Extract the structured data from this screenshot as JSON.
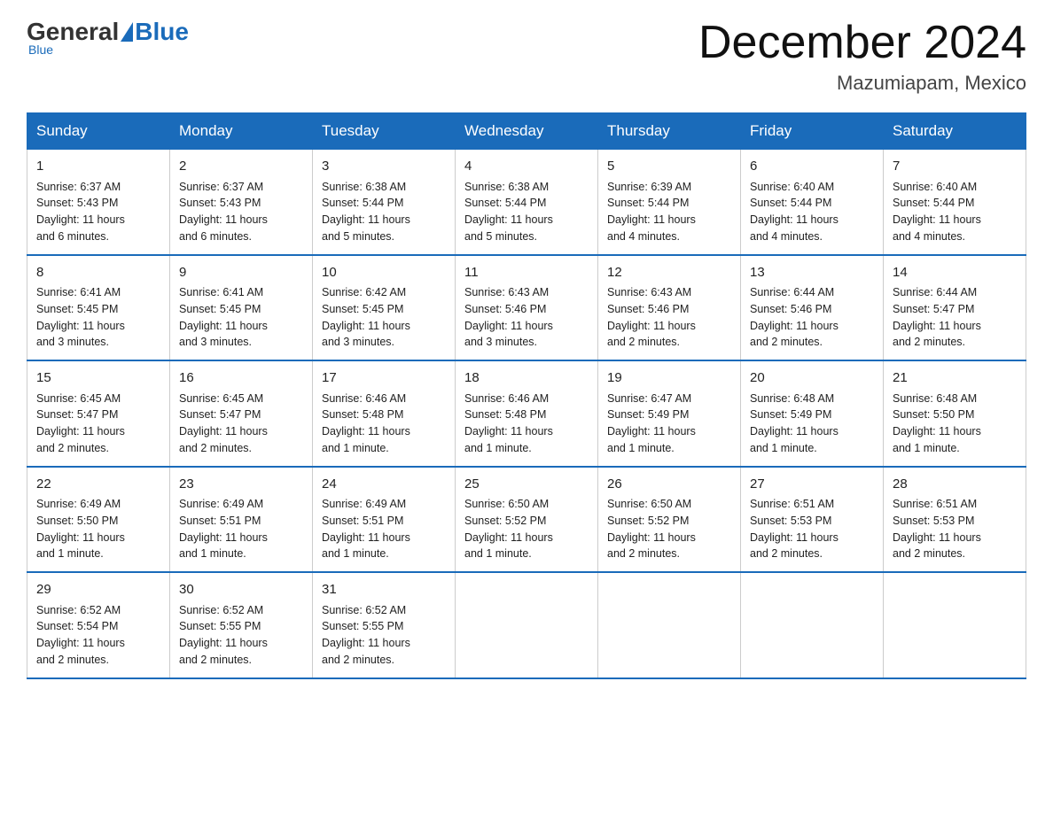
{
  "header": {
    "logo": {
      "general": "General",
      "blue": "Blue",
      "subtitle": "Blue"
    },
    "title": "December 2024",
    "location": "Mazumiapam, Mexico"
  },
  "days_of_week": [
    "Sunday",
    "Monday",
    "Tuesday",
    "Wednesday",
    "Thursday",
    "Friday",
    "Saturday"
  ],
  "weeks": [
    [
      {
        "day": "1",
        "sunrise": "6:37 AM",
        "sunset": "5:43 PM",
        "daylight": "11 hours and 6 minutes."
      },
      {
        "day": "2",
        "sunrise": "6:37 AM",
        "sunset": "5:43 PM",
        "daylight": "11 hours and 6 minutes."
      },
      {
        "day": "3",
        "sunrise": "6:38 AM",
        "sunset": "5:44 PM",
        "daylight": "11 hours and 5 minutes."
      },
      {
        "day": "4",
        "sunrise": "6:38 AM",
        "sunset": "5:44 PM",
        "daylight": "11 hours and 5 minutes."
      },
      {
        "day": "5",
        "sunrise": "6:39 AM",
        "sunset": "5:44 PM",
        "daylight": "11 hours and 4 minutes."
      },
      {
        "day": "6",
        "sunrise": "6:40 AM",
        "sunset": "5:44 PM",
        "daylight": "11 hours and 4 minutes."
      },
      {
        "day": "7",
        "sunrise": "6:40 AM",
        "sunset": "5:44 PM",
        "daylight": "11 hours and 4 minutes."
      }
    ],
    [
      {
        "day": "8",
        "sunrise": "6:41 AM",
        "sunset": "5:45 PM",
        "daylight": "11 hours and 3 minutes."
      },
      {
        "day": "9",
        "sunrise": "6:41 AM",
        "sunset": "5:45 PM",
        "daylight": "11 hours and 3 minutes."
      },
      {
        "day": "10",
        "sunrise": "6:42 AM",
        "sunset": "5:45 PM",
        "daylight": "11 hours and 3 minutes."
      },
      {
        "day": "11",
        "sunrise": "6:43 AM",
        "sunset": "5:46 PM",
        "daylight": "11 hours and 3 minutes."
      },
      {
        "day": "12",
        "sunrise": "6:43 AM",
        "sunset": "5:46 PM",
        "daylight": "11 hours and 2 minutes."
      },
      {
        "day": "13",
        "sunrise": "6:44 AM",
        "sunset": "5:46 PM",
        "daylight": "11 hours and 2 minutes."
      },
      {
        "day": "14",
        "sunrise": "6:44 AM",
        "sunset": "5:47 PM",
        "daylight": "11 hours and 2 minutes."
      }
    ],
    [
      {
        "day": "15",
        "sunrise": "6:45 AM",
        "sunset": "5:47 PM",
        "daylight": "11 hours and 2 minutes."
      },
      {
        "day": "16",
        "sunrise": "6:45 AM",
        "sunset": "5:47 PM",
        "daylight": "11 hours and 2 minutes."
      },
      {
        "day": "17",
        "sunrise": "6:46 AM",
        "sunset": "5:48 PM",
        "daylight": "11 hours and 1 minute."
      },
      {
        "day": "18",
        "sunrise": "6:46 AM",
        "sunset": "5:48 PM",
        "daylight": "11 hours and 1 minute."
      },
      {
        "day": "19",
        "sunrise": "6:47 AM",
        "sunset": "5:49 PM",
        "daylight": "11 hours and 1 minute."
      },
      {
        "day": "20",
        "sunrise": "6:48 AM",
        "sunset": "5:49 PM",
        "daylight": "11 hours and 1 minute."
      },
      {
        "day": "21",
        "sunrise": "6:48 AM",
        "sunset": "5:50 PM",
        "daylight": "11 hours and 1 minute."
      }
    ],
    [
      {
        "day": "22",
        "sunrise": "6:49 AM",
        "sunset": "5:50 PM",
        "daylight": "11 hours and 1 minute."
      },
      {
        "day": "23",
        "sunrise": "6:49 AM",
        "sunset": "5:51 PM",
        "daylight": "11 hours and 1 minute."
      },
      {
        "day": "24",
        "sunrise": "6:49 AM",
        "sunset": "5:51 PM",
        "daylight": "11 hours and 1 minute."
      },
      {
        "day": "25",
        "sunrise": "6:50 AM",
        "sunset": "5:52 PM",
        "daylight": "11 hours and 1 minute."
      },
      {
        "day": "26",
        "sunrise": "6:50 AM",
        "sunset": "5:52 PM",
        "daylight": "11 hours and 2 minutes."
      },
      {
        "day": "27",
        "sunrise": "6:51 AM",
        "sunset": "5:53 PM",
        "daylight": "11 hours and 2 minutes."
      },
      {
        "day": "28",
        "sunrise": "6:51 AM",
        "sunset": "5:53 PM",
        "daylight": "11 hours and 2 minutes."
      }
    ],
    [
      {
        "day": "29",
        "sunrise": "6:52 AM",
        "sunset": "5:54 PM",
        "daylight": "11 hours and 2 minutes."
      },
      {
        "day": "30",
        "sunrise": "6:52 AM",
        "sunset": "5:55 PM",
        "daylight": "11 hours and 2 minutes."
      },
      {
        "day": "31",
        "sunrise": "6:52 AM",
        "sunset": "5:55 PM",
        "daylight": "11 hours and 2 minutes."
      },
      null,
      null,
      null,
      null
    ]
  ]
}
